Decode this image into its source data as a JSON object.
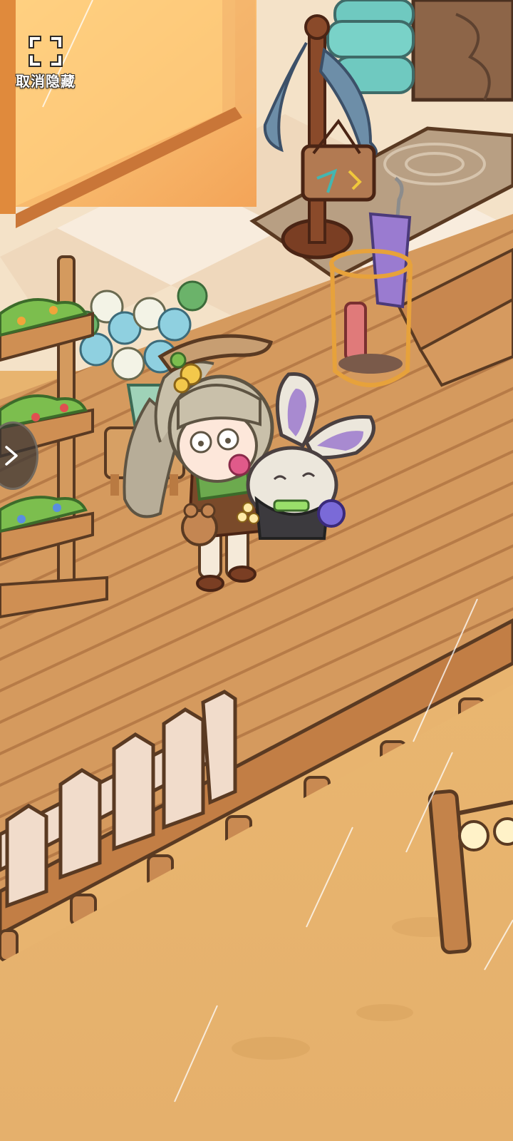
{
  "hud": {
    "cancel_hide_label": "取消隐藏",
    "cancel_hide_icon": "fullscreen-corners-icon",
    "side_expand_icon": "chevron-right-icon"
  },
  "colors": {
    "deck": "#d59a5e",
    "deck_dark": "#9c6338",
    "outline": "#5a3a22",
    "sand": "#e7b36e",
    "fence": "#f1dccb",
    "hud_text": "#ffffff"
  }
}
